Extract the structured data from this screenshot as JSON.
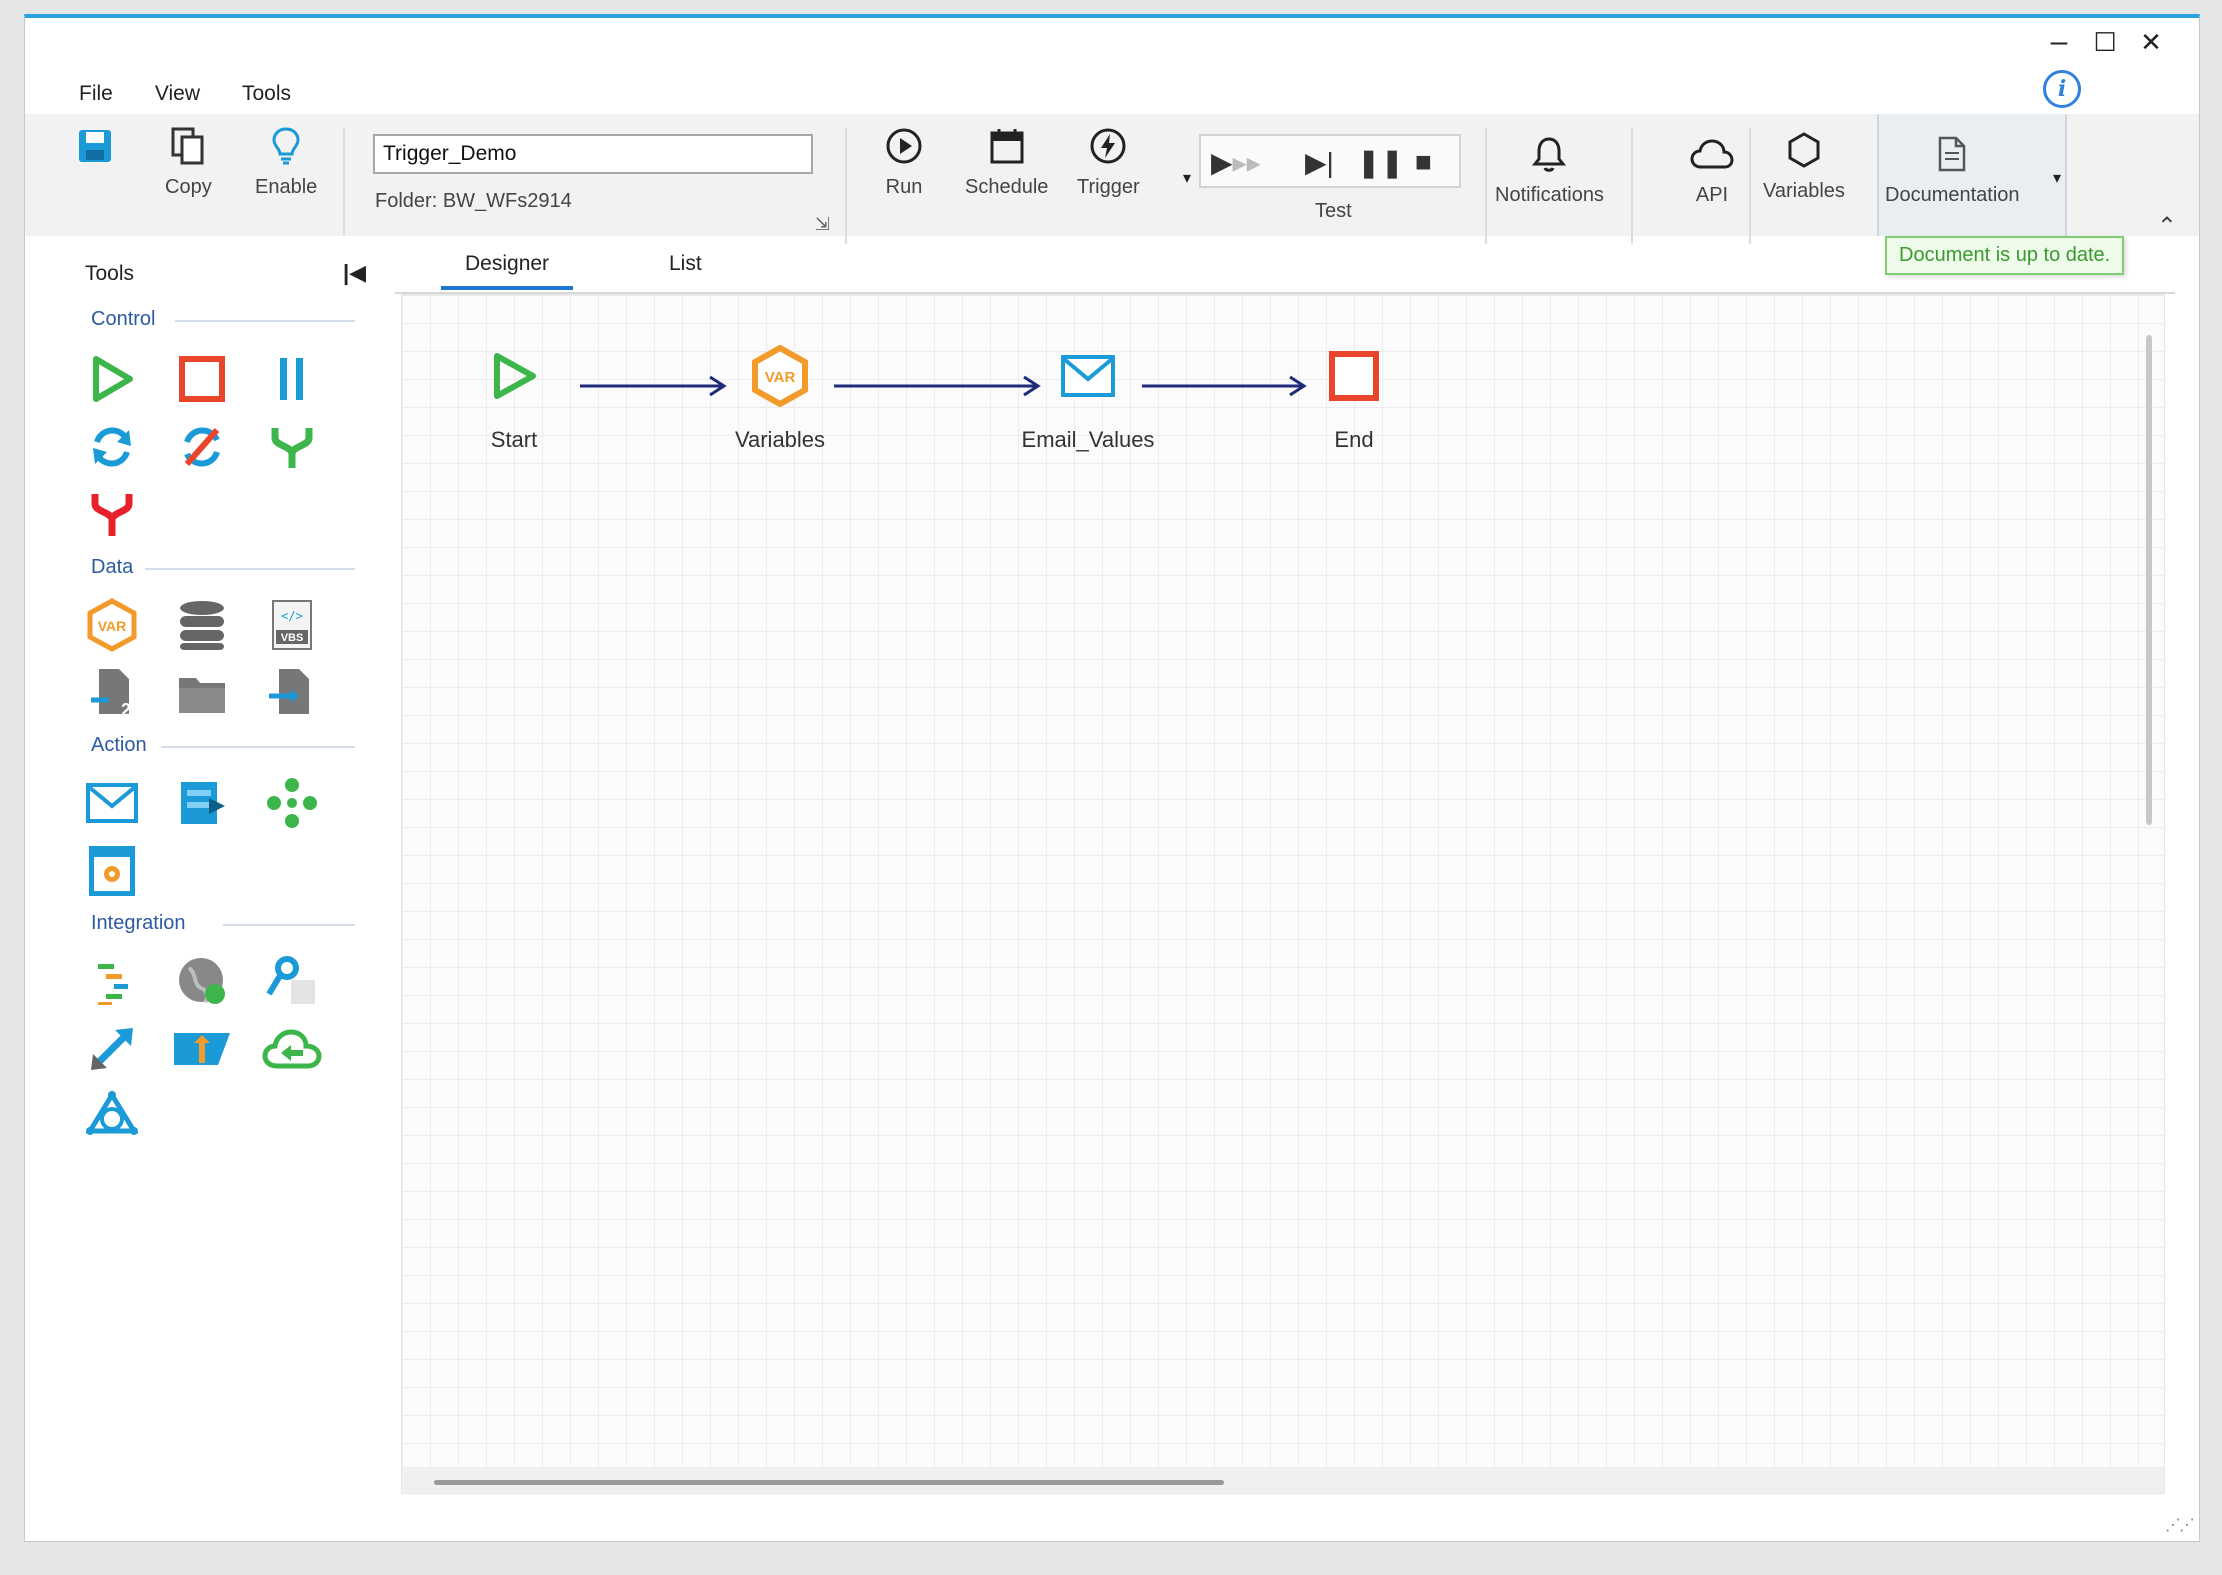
{
  "window": {
    "controls": {
      "minimize": "–",
      "maximize": "☐",
      "close": "✕"
    },
    "accent_color": "#29a3e0"
  },
  "menu": [
    "File",
    "View",
    "Tools"
  ],
  "info_icon": "i",
  "ribbon": {
    "save_icon": "save-icon",
    "copy_label": "Copy",
    "enable_label": "Enable",
    "workflow_name": "Trigger_Demo",
    "folder_label": "Folder:",
    "folder_value": "BW_WFs2914",
    "run_label": "Run",
    "schedule_label": "Schedule",
    "trigger_label": "Trigger",
    "test_label": "Test",
    "notifications_label": "Notifications",
    "api_label": "API",
    "variables_label": "Variables",
    "documentation_label": "Documentation"
  },
  "tooltip": "Document is up to date.",
  "tools_panel": {
    "title": "Tools",
    "groups": [
      {
        "name": "Control",
        "icons": [
          "start-icon",
          "stop-icon",
          "parallel-icon",
          "loop-icon",
          "stop-loop-icon",
          "branch-icon",
          "merge-icon"
        ]
      },
      {
        "name": "Data",
        "icons": [
          "variable-icon",
          "database-icon",
          "vbscript-icon",
          "file-convert-icon",
          "folder-icon",
          "file-import-icon"
        ]
      },
      {
        "name": "Action",
        "icons": [
          "email-icon",
          "export-icon",
          "process-icon",
          "application-icon"
        ]
      },
      {
        "name": "Integration",
        "icons": [
          "api-list-icon",
          "web-icon",
          "key-icon",
          "expand-icon",
          "upload-icon",
          "cloud-sync-icon",
          "network-icon"
        ]
      }
    ]
  },
  "tabs": {
    "designer": "Designer",
    "list": "List"
  },
  "workflow_nodes": [
    {
      "label": "Start",
      "icon": "start-icon"
    },
    {
      "label": "Variables",
      "icon": "variable-icon"
    },
    {
      "label": "Email_Values",
      "icon": "email-icon"
    },
    {
      "label": "End",
      "icon": "end-icon"
    }
  ],
  "colors": {
    "green": "#3cb54a",
    "red": "#e8452b",
    "blue": "#1a9ad6",
    "orange": "#f39b2a",
    "arrow": "#1f2a7a",
    "group_title": "#2c5aa0"
  }
}
